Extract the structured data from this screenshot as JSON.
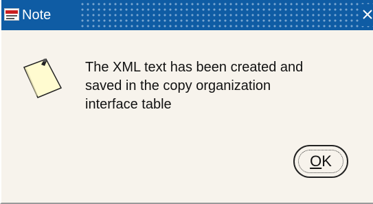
{
  "window": {
    "title": "Note",
    "app_logo": "oracle-applications-logo",
    "close_icon": "close-icon"
  },
  "dialog": {
    "icon": "note-icon",
    "message": "The XML text has been created and\nsaved in the copy organization\ninterface table",
    "ok_mnemonic": "O",
    "ok_rest": "K"
  },
  "colors": {
    "titlebar": "#0f5ca4",
    "background": "#f7f3ec",
    "note": "#fffbd0"
  }
}
